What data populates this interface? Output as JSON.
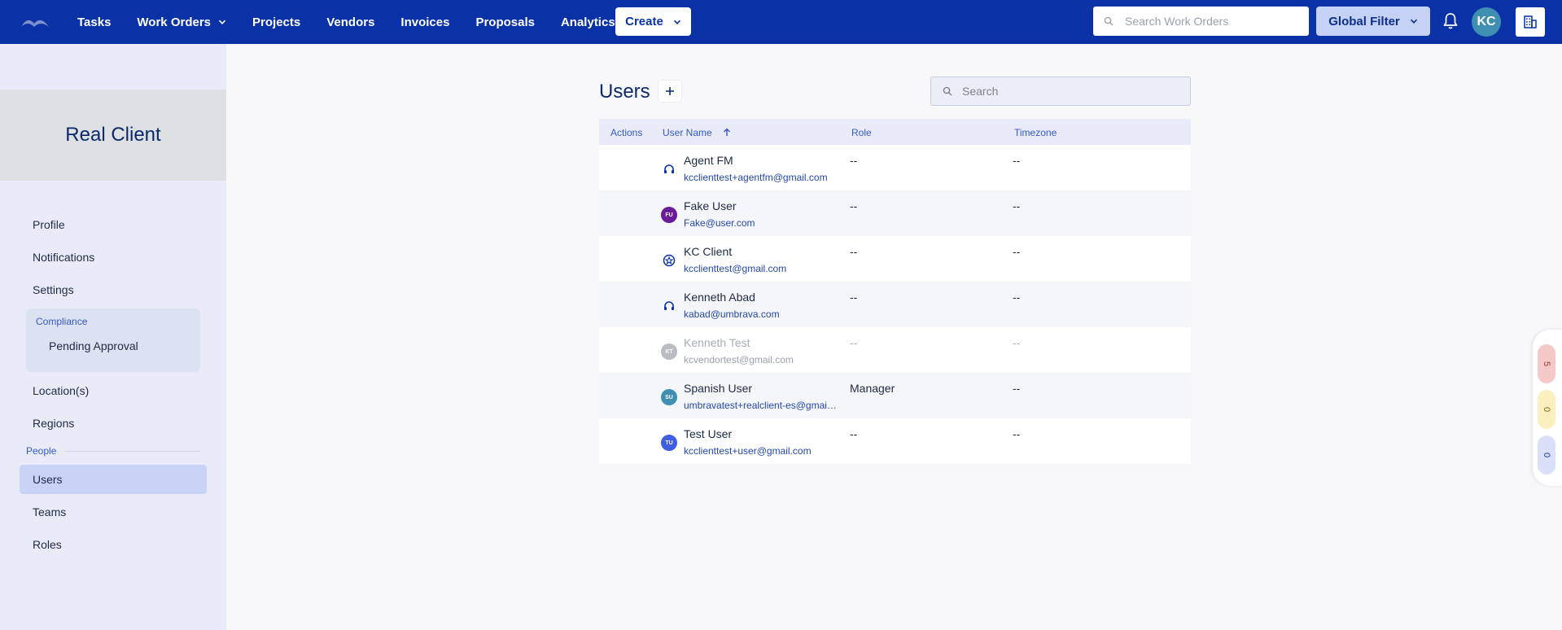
{
  "nav": {
    "items": [
      {
        "label": "Tasks",
        "dropdown": false
      },
      {
        "label": "Work Orders",
        "dropdown": true
      },
      {
        "label": "Projects",
        "dropdown": false
      },
      {
        "label": "Vendors",
        "dropdown": false
      },
      {
        "label": "Invoices",
        "dropdown": false
      },
      {
        "label": "Proposals",
        "dropdown": false
      },
      {
        "label": "Analytics",
        "dropdown": true
      }
    ],
    "create_label": "Create",
    "search_placeholder": "Search Work Orders",
    "global_filter_label": "Global Filter",
    "avatar_initials": "KC",
    "brand_color": "#0a31a5"
  },
  "sidebar": {
    "client_name": "Real Client",
    "items_top": [
      "Profile",
      "Notifications",
      "Settings"
    ],
    "compliance": {
      "label": "Compliance",
      "items": [
        "Pending Approval"
      ]
    },
    "items_mid": [
      "Location(s)",
      "Regions"
    ],
    "people_label": "People",
    "people_items": [
      "Users",
      "Teams",
      "Roles"
    ],
    "active_item": "Users"
  },
  "main": {
    "title": "Users",
    "search_placeholder": "Search",
    "columns": {
      "actions": "Actions",
      "user_name": "User Name",
      "role": "Role",
      "timezone": "Timezone"
    },
    "sort_column": "User Name",
    "sort_direction": "ascending",
    "rows": [
      {
        "name": "Agent FM",
        "email": "kcclienttest+agentfm@gmail.com",
        "role": "--",
        "timezone": "--",
        "avatar": "headset-icon",
        "avatar_initials": "",
        "avatar_color": "#0a31a5",
        "muted": false
      },
      {
        "name": "Fake User",
        "email": "Fake@user.com",
        "role": "--",
        "timezone": "--",
        "avatar": "initials",
        "avatar_initials": "FU",
        "avatar_color": "#6a1b9a",
        "muted": false
      },
      {
        "name": "KC Client",
        "email": "kcclienttest@gmail.com",
        "role": "--",
        "timezone": "--",
        "avatar": "star-badge-icon",
        "avatar_initials": "",
        "avatar_color": "#0a31a5",
        "muted": false
      },
      {
        "name": "Kenneth Abad",
        "email": "kabad@umbrava.com",
        "role": "--",
        "timezone": "--",
        "avatar": "headset-icon",
        "avatar_initials": "",
        "avatar_color": "#0a31a5",
        "muted": false
      },
      {
        "name": "Kenneth Test",
        "email": "kcvendortest@gmail.com",
        "role": "--",
        "timezone": "--",
        "avatar": "initials",
        "avatar_initials": "KT",
        "avatar_color": "#b8bcc4",
        "muted": true
      },
      {
        "name": "Spanish User",
        "email": "umbravatest+realclient-es@gmail.com",
        "role": "Manager",
        "timezone": "--",
        "avatar": "initials",
        "avatar_initials": "SU",
        "avatar_color": "#3e8fb2",
        "muted": false
      },
      {
        "name": "Test User",
        "email": "kcclienttest+user@gmail.com",
        "role": "--",
        "timezone": "--",
        "avatar": "initials",
        "avatar_initials": "TU",
        "avatar_color": "#3f5de0",
        "muted": false
      }
    ]
  },
  "counters": [
    {
      "value": "5",
      "bg": "#f6c9c9",
      "color": "#b03030"
    },
    {
      "value": "0",
      "bg": "#fbf0bd",
      "color": "#7a6a10"
    },
    {
      "value": "0",
      "bg": "#d9e0f7",
      "color": "#1f3a9a"
    }
  ]
}
